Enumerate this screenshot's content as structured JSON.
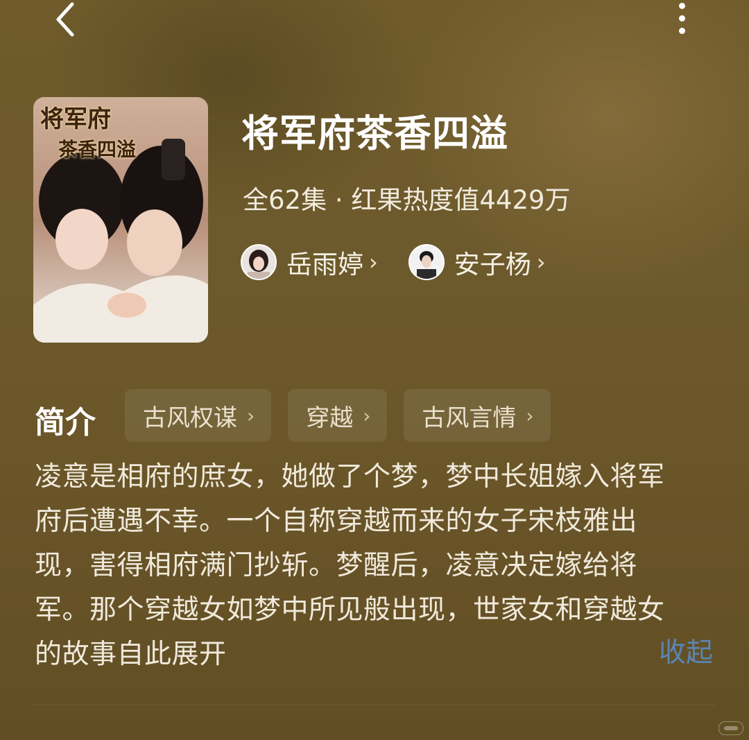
{
  "header": {
    "back_icon": "chevron-left-icon",
    "more_icon": "more-vertical-icon"
  },
  "poster": {
    "title_line1": "将军府",
    "title_line2": "茶香四溢"
  },
  "drama": {
    "title": "将军府茶香四溢",
    "meta": "全62集 · 红果热度值4429万"
  },
  "actors": [
    {
      "name": "岳雨婷",
      "chevron": "›"
    },
    {
      "name": "安子杨",
      "chevron": "›"
    }
  ],
  "intro": {
    "label": "简介",
    "tags": [
      {
        "label": "古风权谋",
        "chevron": "›"
      },
      {
        "label": "穿越",
        "chevron": "›"
      },
      {
        "label": "古风言情",
        "chevron": "›"
      }
    ],
    "description_lines": [
      "凌意是相府的庶女，她做了个梦，梦中长姐嫁入将军",
      "府后遭遇不幸。一个自称穿越而来的女子宋枝雅出",
      "现，害得相府满门抄斩。梦醒后，凌意决定嫁给将",
      "军。那个穿越女如梦中所见般出现，世家女和穿越女",
      "的故事自此展开"
    ],
    "collapse_label": "收起"
  },
  "colors": {
    "accent_link": "#5a86b4",
    "background": "#6d5a2c"
  }
}
